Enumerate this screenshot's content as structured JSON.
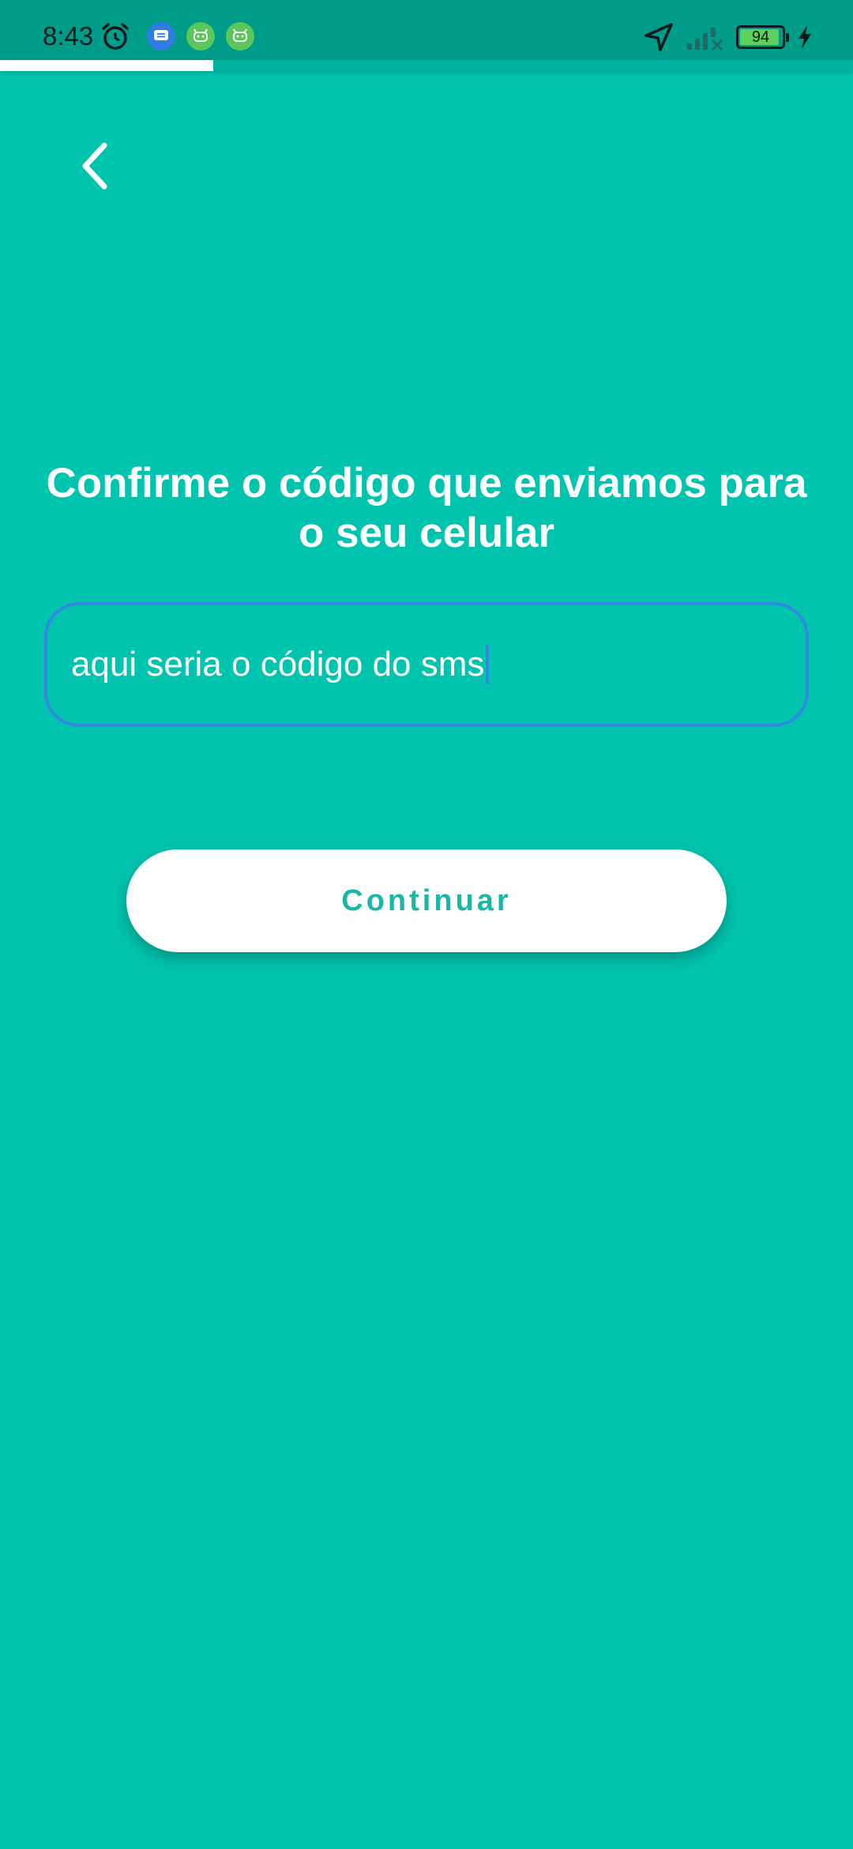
{
  "status_bar": {
    "time": "8:43",
    "battery_level": "94",
    "icons": [
      "alarm-icon",
      "messages-notification-icon",
      "android-notification-icon",
      "android-notification-icon",
      "location-icon",
      "signal-icon",
      "battery-icon",
      "charging-icon"
    ]
  },
  "progress": {
    "value": 0.25
  },
  "header": {
    "back_icon": "chevron-left-icon"
  },
  "main": {
    "title": "Confirme o código que enviamos para o seu celular",
    "code_input": {
      "value": "aqui seria o código do sms"
    },
    "continue_label": "Continuar"
  },
  "colors": {
    "background": "#00c4ae",
    "status_bar": "#009c8a",
    "input_border": "#2f8be0",
    "button_text": "#1bb6a4",
    "button_bg": "#ffffff"
  }
}
